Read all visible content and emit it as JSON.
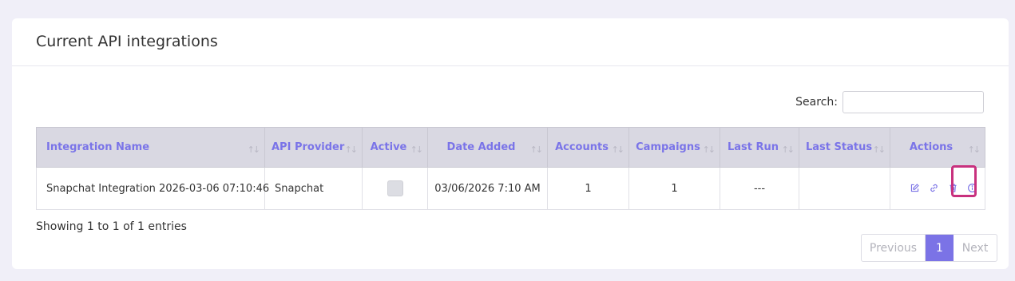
{
  "card": {
    "title": "Current API integrations"
  },
  "search": {
    "label": "Search:",
    "value": "",
    "placeholder": ""
  },
  "table": {
    "columns": [
      {
        "label": "Integration Name"
      },
      {
        "label": "API Provider"
      },
      {
        "label": "Active"
      },
      {
        "label": "Date Added"
      },
      {
        "label": "Accounts"
      },
      {
        "label": "Campaigns"
      },
      {
        "label": "Last Run"
      },
      {
        "label": "Last Status"
      },
      {
        "label": "Actions"
      }
    ],
    "rows": [
      {
        "name": "Snapchat Integration 2026-03-06 07:10:46",
        "provider": "Snapchat",
        "active": false,
        "date_added": "03/06/2026 7:10 AM",
        "accounts": "1",
        "campaigns": "1",
        "last_run": "---",
        "last_status": ""
      }
    ],
    "sort_glyph": "↑↓"
  },
  "footer": {
    "info": "Showing 1 to 1 of 1 entries",
    "pagination": {
      "previous": "Previous",
      "current": "1",
      "next": "Next"
    }
  },
  "colors": {
    "accent": "#7b73e6",
    "highlight": "#c8317e",
    "header_bg": "#d9d8e2"
  },
  "icons": [
    "edit-icon",
    "link-icon",
    "trash-icon",
    "info-icon"
  ]
}
